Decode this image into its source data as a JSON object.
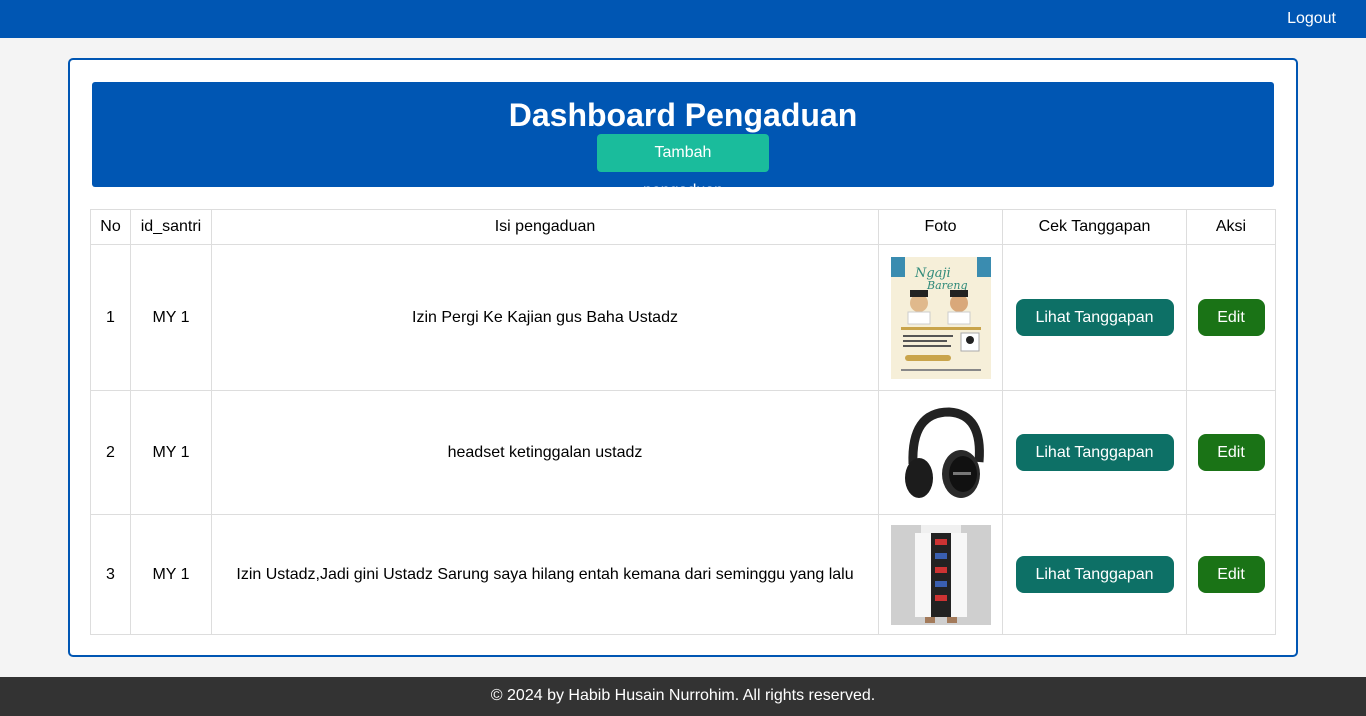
{
  "nav": {
    "logout": "Logout"
  },
  "header": {
    "title": "Dashboard Pengaduan",
    "add_button": "Tambah pengaduan"
  },
  "table": {
    "headers": [
      "No",
      "id_santri",
      "Isi pengaduan",
      "Foto",
      "Cek Tanggapan",
      "Aksi"
    ],
    "rows": [
      {
        "no": "1",
        "id_santri": "MY 1",
        "isi": "Izin Pergi Ke Kajian gus Baha Ustadz",
        "photo_icon": "poster-image",
        "view_label": "Lihat Tanggapan",
        "edit_label": "Edit"
      },
      {
        "no": "2",
        "id_santri": "MY 1",
        "isi": "headset ketinggalan ustadz",
        "photo_icon": "headphones-image",
        "view_label": "Lihat Tanggapan",
        "edit_label": "Edit"
      },
      {
        "no": "3",
        "id_santri": "MY 1",
        "isi": "Izin Ustadz,Jadi gini Ustadz Sarung saya hilang entah kemana dari seminggu yang lalu",
        "photo_icon": "sarong-image",
        "view_label": "Lihat Tanggapan",
        "edit_label": "Edit"
      }
    ]
  },
  "footer": {
    "text": "© 2024 by Habib Husain Nurrohim. All rights reserved."
  },
  "colors": {
    "primary": "#0056b3",
    "accent": "#1abc9c",
    "view_button": "#0d7066",
    "edit_button": "#1a7316",
    "footer": "#333333"
  }
}
